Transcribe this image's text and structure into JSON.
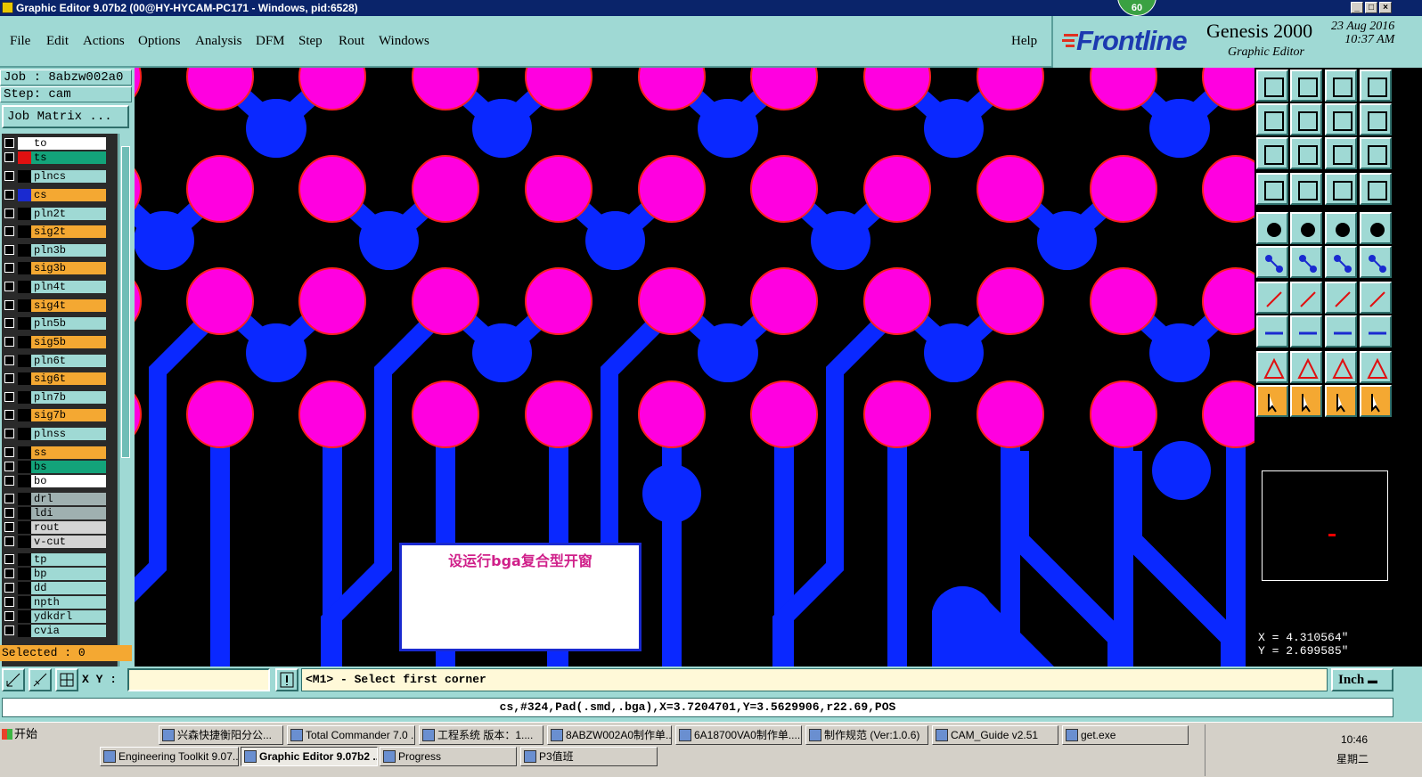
{
  "window": {
    "title": "Graphic Editor 9.07b2 (00@HY-HYCAM-PC171 - Windows, pid:6528)",
    "badge": "60"
  },
  "menu": {
    "items": [
      "File",
      "Edit",
      "Actions",
      "Options",
      "Analysis",
      "DFM",
      "Step",
      "Rout",
      "Windows"
    ],
    "help": "Help"
  },
  "brand": {
    "logo": "Frontline",
    "product": "Genesis 2000",
    "subtitle": "Graphic Editor",
    "date": "23 Aug 2016",
    "time": "10:37 AM"
  },
  "job": {
    "job_line": "Job : 8abzw002a0",
    "step_line": "Step: cam",
    "matrix_button": "Job Matrix ...",
    "selected": "Selected : 0"
  },
  "layers": [
    {
      "name": "to",
      "color": "#ffffff",
      "box": "#ffffff"
    },
    {
      "name": "ts",
      "color": "#13a37a",
      "box": "#e01010"
    },
    {
      "name": "plncs",
      "color": "#9fd9d4",
      "box": "#000000"
    },
    {
      "name": "cs",
      "color": "#f4a832",
      "box": "#1a2ad0"
    },
    {
      "name": "pln2t",
      "color": "#9fd9d4",
      "box": "#000000"
    },
    {
      "name": "sig2t",
      "color": "#f4a832",
      "box": "#000000"
    },
    {
      "name": "pln3b",
      "color": "#9fd9d4",
      "box": "#000000"
    },
    {
      "name": "sig3b",
      "color": "#f4a832",
      "box": "#000000"
    },
    {
      "name": "pln4t",
      "color": "#9fd9d4",
      "box": "#000000"
    },
    {
      "name": "sig4t",
      "color": "#f4a832",
      "box": "#000000"
    },
    {
      "name": "pln5b",
      "color": "#9fd9d4",
      "box": "#000000"
    },
    {
      "name": "sig5b",
      "color": "#f4a832",
      "box": "#000000"
    },
    {
      "name": "pln6t",
      "color": "#9fd9d4",
      "box": "#000000"
    },
    {
      "name": "sig6t",
      "color": "#f4a832",
      "box": "#000000"
    },
    {
      "name": "pln7b",
      "color": "#9fd9d4",
      "box": "#000000"
    },
    {
      "name": "sig7b",
      "color": "#f4a832",
      "box": "#000000"
    },
    {
      "name": "plnss",
      "color": "#9fd9d4",
      "box": "#000000"
    },
    {
      "name": "ss",
      "color": "#f4a832",
      "box": "#000000"
    },
    {
      "name": "bs",
      "color": "#13a37a",
      "box": "#000000"
    },
    {
      "name": "bo",
      "color": "#ffffff",
      "box": "#000000"
    },
    {
      "name": "drl",
      "color": "#9fb0b0",
      "box": "#000000"
    },
    {
      "name": "ldi",
      "color": "#9fb0b0",
      "box": "#000000"
    },
    {
      "name": "rout",
      "color": "#d4d4d4",
      "box": "#000000"
    },
    {
      "name": "v-cut",
      "color": "#d4d4d4",
      "box": "#000000"
    },
    {
      "name": "tp",
      "color": "#9fd9d4",
      "box": "#000000"
    },
    {
      "name": "bp",
      "color": "#9fd9d4",
      "box": "#000000"
    },
    {
      "name": "dd",
      "color": "#9fd9d4",
      "box": "#000000"
    },
    {
      "name": "npth",
      "color": "#9fd9d4",
      "box": "#000000"
    },
    {
      "name": "ydkdrl",
      "color": "#9fd9d4",
      "box": "#000000"
    },
    {
      "name": "cvia",
      "color": "#9fd9d4",
      "box": "#000000"
    }
  ],
  "canvas": {
    "note_text": "设运行bga复合型开窗",
    "pad_color": "#ff00e0",
    "pad_outline": "#ff2020",
    "trace_color": "#0a28ff",
    "background": "#000000"
  },
  "coords": {
    "x": "X = 4.310564\"",
    "y": "Y = 2.699585\""
  },
  "command": {
    "xy_label": "X Y :",
    "xy_value": "",
    "prompt": "<M1> - Select first corner",
    "units": "Inch"
  },
  "status": {
    "text": "cs,#324,Pad(.smd,.bga),X=3.7204701,Y=3.5629906,r22.69,POS"
  },
  "taskbar": {
    "start": "开始",
    "row1": [
      "兴森快捷衡阳分公...",
      "Total Commander 7.0 ...",
      "工程系统  版本：1....",
      "8ABZW002A0制作单....",
      "6A18700VA0制作单....",
      "制作规范 (Ver:1.0.6)",
      "CAM_Guide v2.51",
      "get.exe"
    ],
    "row2": [
      "Engineering Toolkit 9.07...",
      "Graphic Editor 9.07b2 ...",
      "Progress",
      "P3值班"
    ],
    "clock": "10:46",
    "weekday": "星期二"
  }
}
